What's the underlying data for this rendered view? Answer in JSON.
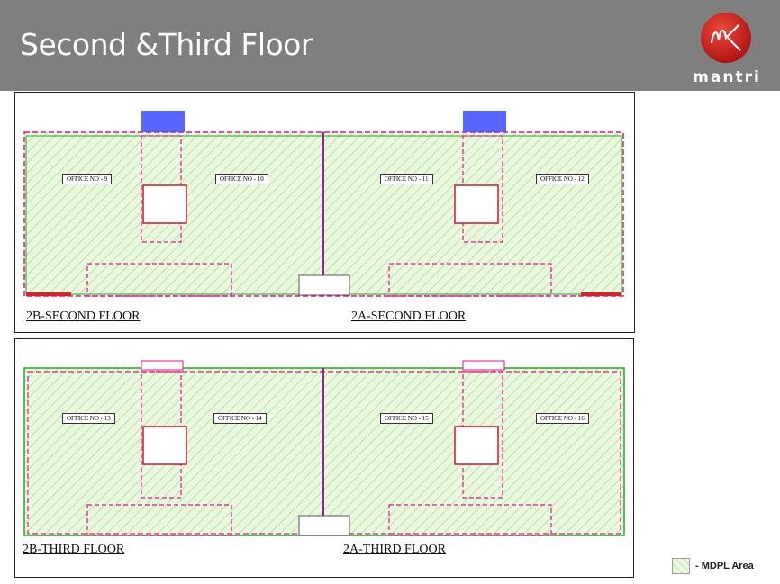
{
  "header": {
    "title": "Second &Third Floor"
  },
  "logo": {
    "text": "mantri"
  },
  "colors": {
    "header_bg": "#7f7f7f",
    "mdpl_fill": "#d8f0c8",
    "wall": "#e8128c",
    "logo_red": "#cc1b1b"
  },
  "panels": [
    {
      "labels": [
        "2B-SECOND FLOOR",
        "2A-SECOND FLOOR"
      ],
      "offices": [
        "OFFICE NO - 9",
        "OFFICE NO - 10",
        "OFFICE NO - 11",
        "OFFICE NO - 12"
      ]
    },
    {
      "labels": [
        "2B-THIRD FLOOR",
        "2A-THIRD FLOOR"
      ],
      "offices": [
        "OFFICE NO - 13",
        "OFFICE NO - 14",
        "OFFICE NO - 15",
        "OFFICE NO - 16"
      ]
    }
  ],
  "legend": {
    "label": "- MDPL Area"
  }
}
